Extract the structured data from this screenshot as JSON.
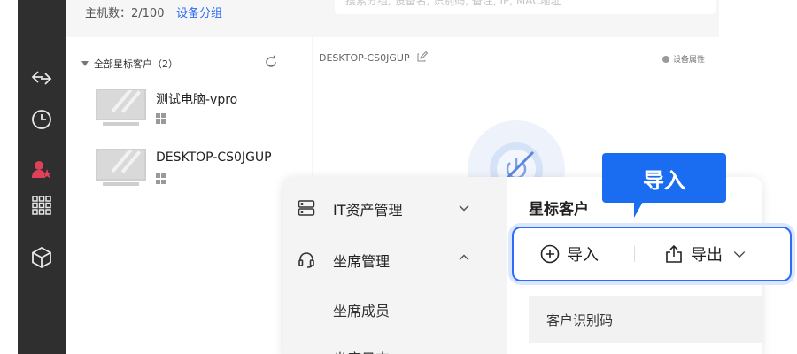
{
  "header": {
    "host_count": "主机数：2/100",
    "device_group_link": "设备分组",
    "search_placeholder": "搜索分组, 设备名, 识别码, 备注, IP, MAC地址"
  },
  "list": {
    "group_title": "全部星标客户（2）",
    "devices": [
      {
        "name": "测试电脑-vpro",
        "os": "windows-icon"
      },
      {
        "name": "DESKTOP-CS0JGUP",
        "os": "windows-icon"
      }
    ]
  },
  "detail": {
    "device_title": "DESKTOP-CS0JGUP",
    "device_attributes": "设备属性"
  },
  "menu": {
    "items": [
      {
        "label": "IT资产管理",
        "icon": "server-icon",
        "expanded": false
      },
      {
        "label": "坐席管理",
        "icon": "headset-icon",
        "expanded": true
      }
    ],
    "sub_items": [
      "坐席成员",
      "坐席日志"
    ]
  },
  "panel": {
    "title": "星标客户",
    "import_label": "导入",
    "export_label": "导出",
    "tooltip": "导入",
    "column_header": "客户识别码"
  },
  "colors": {
    "accent": "#2d6cf6",
    "tooltip": "#1a6cf0",
    "rail": "#2f2f2f",
    "active_rail_icon": "#e0405a"
  }
}
